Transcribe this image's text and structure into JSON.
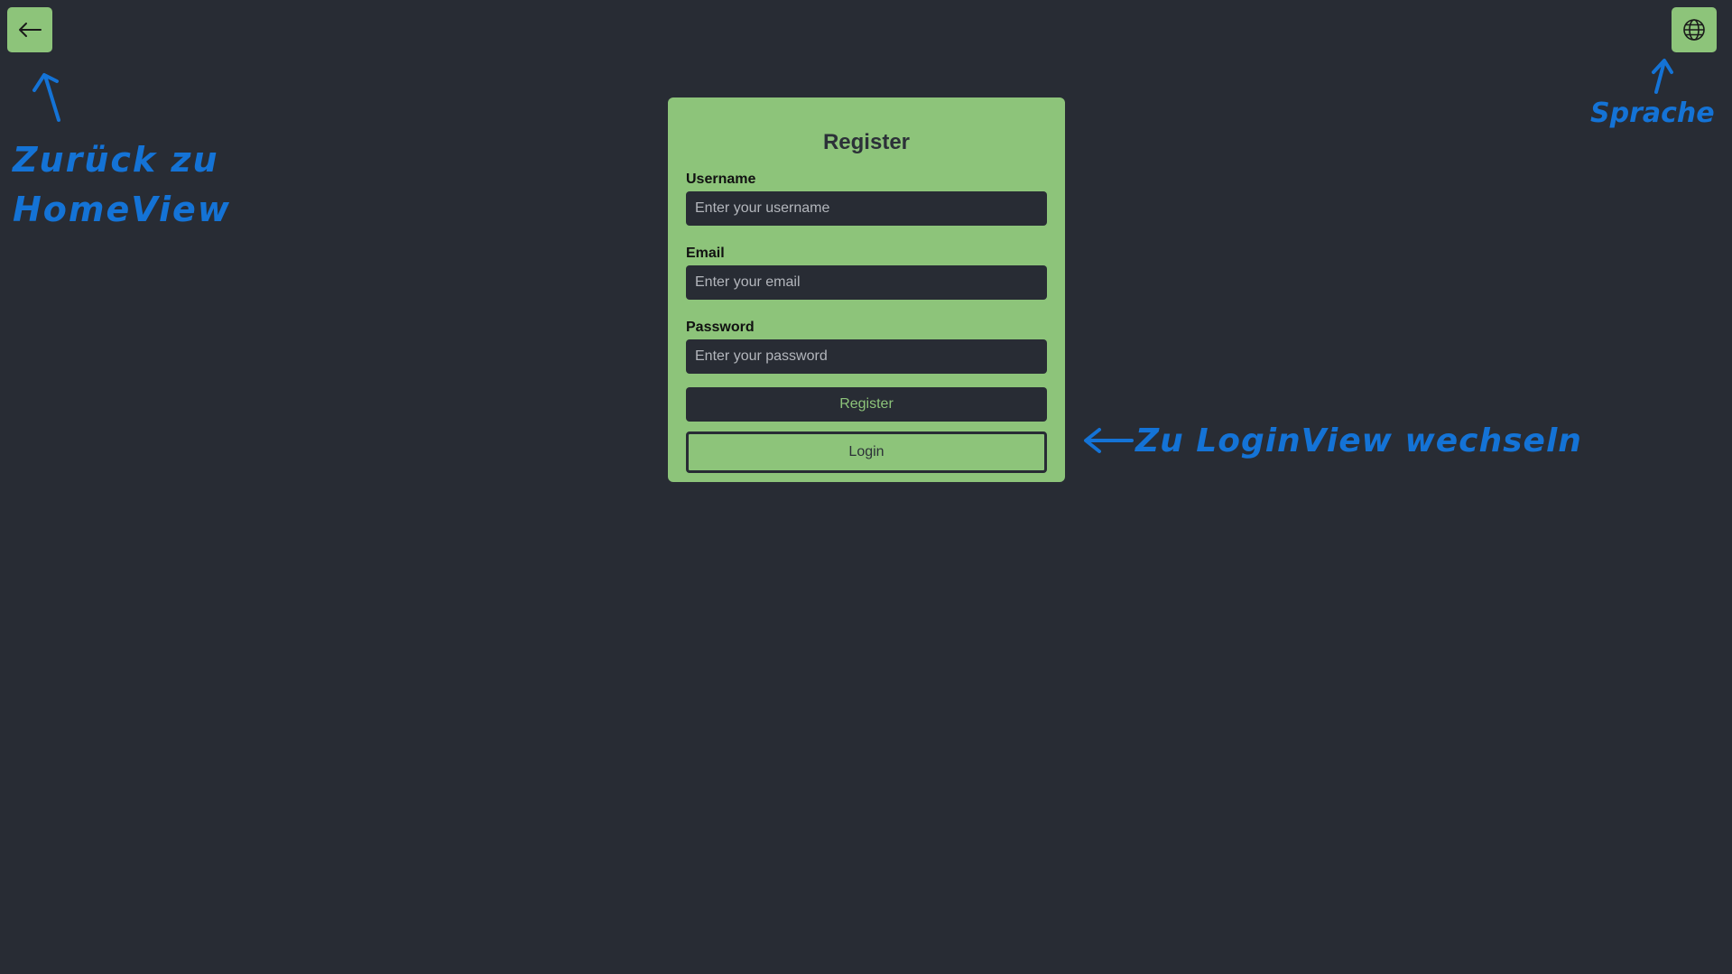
{
  "header": {
    "back_icon": "arrow-left-icon",
    "language_icon": "globe-icon"
  },
  "register_form": {
    "title": "Register",
    "username": {
      "label": "Username",
      "placeholder": "Enter your username",
      "value": ""
    },
    "email": {
      "label": "Email",
      "placeholder": "Enter your email",
      "value": ""
    },
    "password": {
      "label": "Password",
      "placeholder": "Enter your password",
      "value": ""
    },
    "register_button": "Register",
    "login_button": "Login"
  },
  "annotations": {
    "back": "Zurück zu HomeView",
    "language": "Sprache",
    "login": "Zu LoginView wechseln"
  },
  "colors": {
    "background": "#282c34",
    "accent_green": "#8dc47a",
    "annotation_blue": "#1473d6"
  }
}
